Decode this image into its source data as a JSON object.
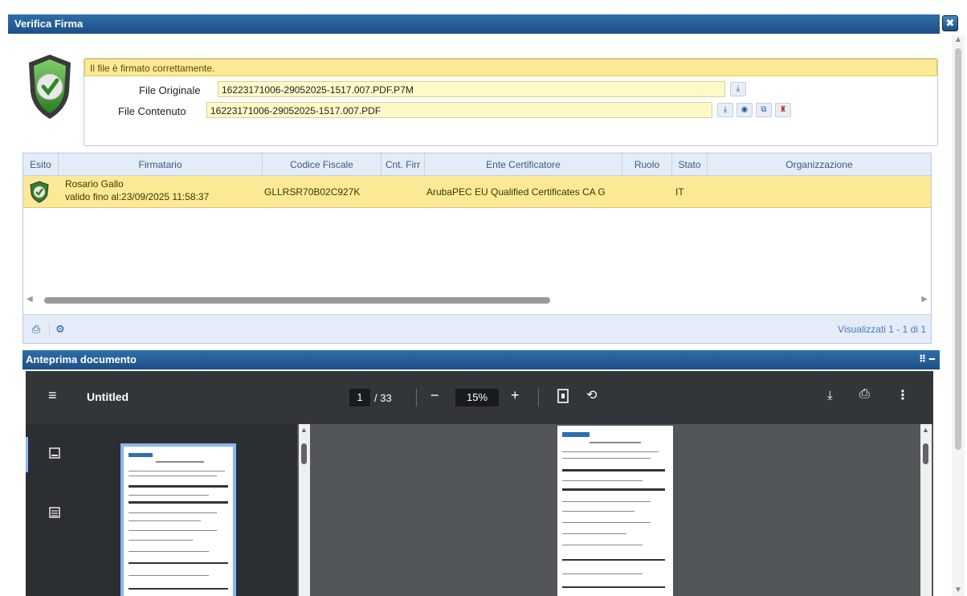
{
  "dialog": {
    "title": "Verifica Firma",
    "close_glyph": "✖"
  },
  "verification": {
    "message": "Il file è firmato correttamente.",
    "original_label": "File Originale",
    "original_value": "16223171006-29052025-1517.007.PDF.P7M",
    "content_label": "File Contenuto",
    "content_value": "16223171006-29052025-1517.007.PDF"
  },
  "grid": {
    "columns": [
      "Esito",
      "Firmatario",
      "Codice Fiscale",
      "Cnt. Firr",
      "Ente Certificatore",
      "Ruolo",
      "Stato",
      "Organizzazione"
    ],
    "rows": [
      {
        "signer_name": "Rosario Gallo",
        "signer_validity": "valido fino al:23/09/2025 11:58:37",
        "fiscal_code": "GLLRSR70B02C927K",
        "count": "",
        "certifier": "ArubaPEC EU Qualified Certificates CA G",
        "role": "",
        "state": "IT",
        "organization": ""
      }
    ],
    "footer_text": "Visualizzati 1 - 1 di 1"
  },
  "preview": {
    "title": "Anteprima documento",
    "doc_title": "Untitled",
    "page_current": "1",
    "page_total": "/ 33",
    "zoom": "15%",
    "minimize_glyph": "━",
    "expand_glyph": "⠿"
  },
  "colors": {
    "accent": "#1c4f86",
    "highlight": "#fbe996",
    "pdf_toolbar": "#323639"
  }
}
